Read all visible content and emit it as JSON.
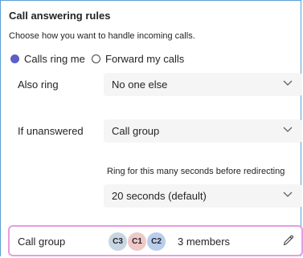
{
  "header": {
    "title": "Call answering rules",
    "subtitle": "Choose how you want to handle incoming calls."
  },
  "options": [
    {
      "label": "Calls ring me",
      "selected": true
    },
    {
      "label": "Forward my calls",
      "selected": false
    }
  ],
  "also_ring": {
    "label": "Also ring",
    "value": "No one else"
  },
  "if_unanswered": {
    "label": "If unanswered",
    "value": "Call group"
  },
  "ring_timeout": {
    "label": "Ring for this many seconds before redirecting",
    "value": "20 seconds (default)"
  },
  "call_group": {
    "label": "Call group",
    "avatars": [
      {
        "initials": "C3",
        "color": "#c7d6e2"
      },
      {
        "initials": "C1",
        "color": "#efc8c8"
      },
      {
        "initials": "C2",
        "color": "#b9cdec"
      }
    ],
    "members": "3 members",
    "highlight_color": "#e79de0"
  },
  "colors": {
    "accent": "#5b5fc7",
    "border": "#5b9fd6",
    "field_bg": "#f5f5f5"
  },
  "icons": {
    "dropdown": "chevron-down-icon",
    "edit": "pencil-icon"
  }
}
